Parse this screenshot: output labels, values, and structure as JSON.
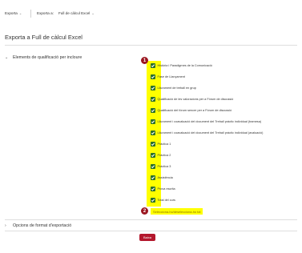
{
  "topbar": {
    "export_menu": "Exporta",
    "export_as_label": "Exporta a:",
    "export_as_value": "Full de càlcul Excel"
  },
  "page_title": "Exporta a Full de càlcul Excel",
  "grade_items_section": {
    "title": "Elements de qualificació per incloure",
    "items": [
      {
        "label": "Història i Paradigmes de la Comunicació",
        "checked": true
      },
      {
        "label": "Fase de Llançament",
        "checked": true
      },
      {
        "label": "Lliurament de treball en grup",
        "checked": true
      },
      {
        "label": "Qualificació de les valoracions per a Fòrum de discussió",
        "checked": true
      },
      {
        "label": "Qualificació del fòrum sencer per a Fòrum de discussió",
        "checked": true
      },
      {
        "label": "Lliurament i coavaluació del document del Treball pràctic individual (tramesa)",
        "checked": true
      },
      {
        "label": "Lliurament i coavaluació del document del Treball pràctic individual (avaluació)",
        "checked": true
      },
      {
        "label": "Pràctica 1",
        "checked": true
      },
      {
        "label": "Pràctica 2",
        "checked": true
      },
      {
        "label": "Pràctica 3",
        "checked": true
      },
      {
        "label": "Assistència",
        "checked": true
      },
      {
        "label": "Prova escrita",
        "checked": true
      },
      {
        "label": "Total del curs",
        "checked": true
      }
    ],
    "select_all_link": "Selecciona-ho/deselecciona-ho tot"
  },
  "badges": {
    "first": "1",
    "second": "2"
  },
  "format_options_section": {
    "title": "Opcions de format d'exportació"
  },
  "export_button": "Baixa",
  "colors": {
    "accent": "#b3172c",
    "highlight": "#ffff00",
    "checkbox": "#2a6f2a",
    "badge": "#9b1620"
  }
}
